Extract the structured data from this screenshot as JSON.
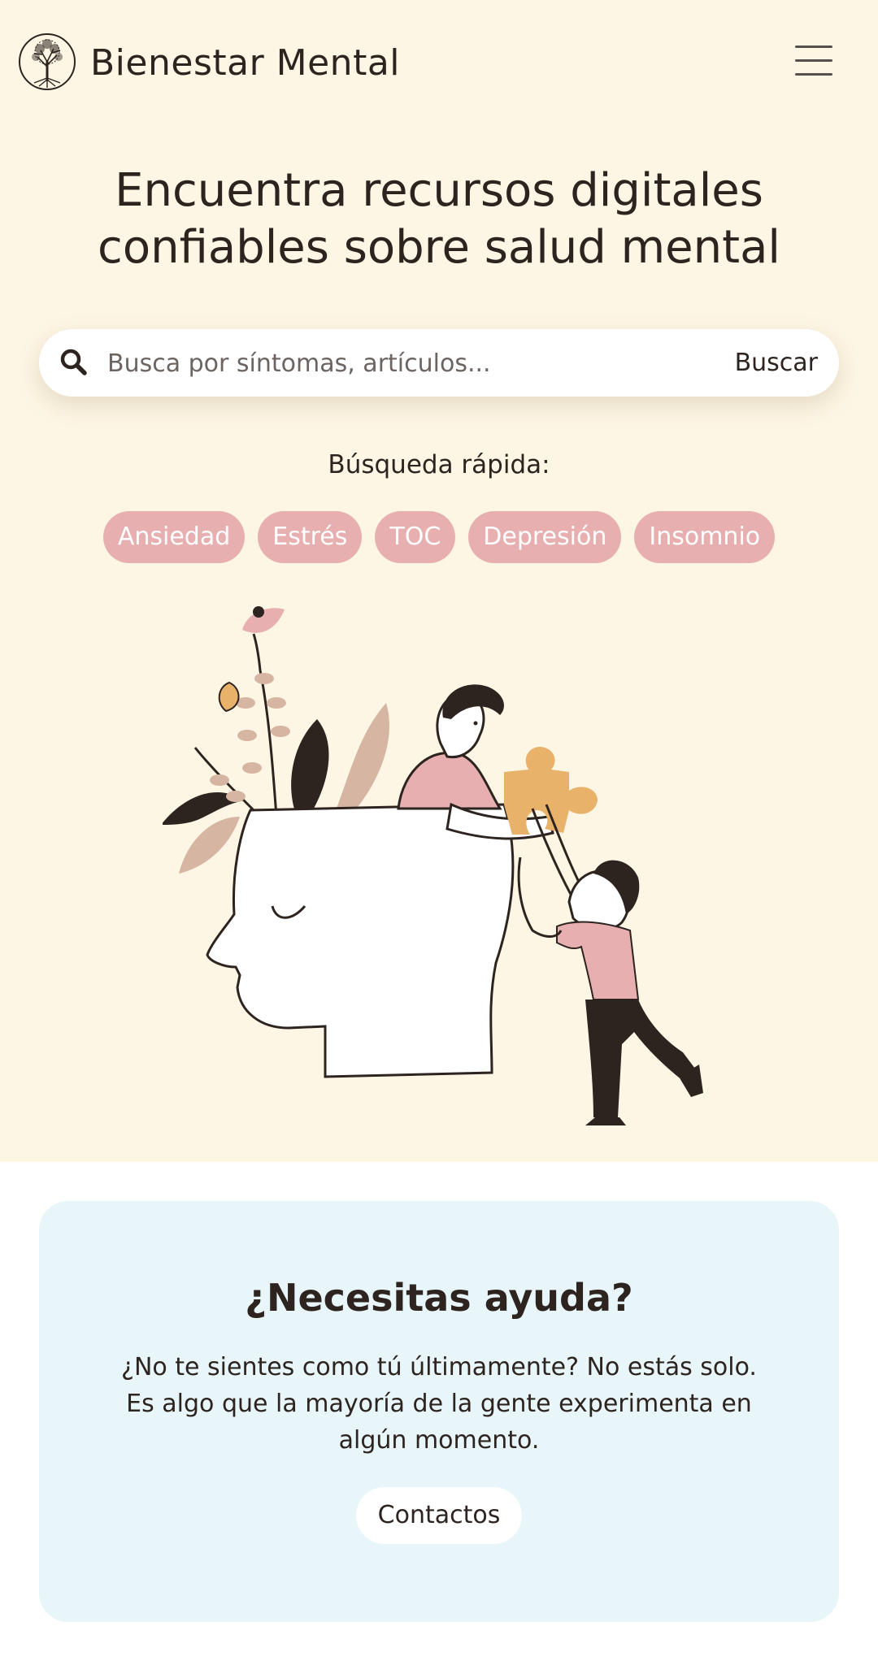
{
  "header": {
    "brand": "Bienestar Mental",
    "logo_icon": "tree-of-life-icon",
    "menu_icon": "hamburger-menu-icon"
  },
  "hero": {
    "headline_line1": "Encuentra recursos digitales",
    "headline_line2": "confiables sobre salud mental",
    "background_color": "#fdf6e4"
  },
  "search": {
    "icon": "search-icon",
    "placeholder": "Busca por síntomas, artículos...",
    "value": "",
    "button_label": "Buscar"
  },
  "quick_search": {
    "label": "Búsqueda rápida:",
    "chip_color": "#e8afb1",
    "chips": [
      "Ansiedad",
      "Estrés",
      "TOC",
      "Depresión",
      "Insomnio"
    ]
  },
  "help": {
    "title": "¿Necesitas ayuda?",
    "text": "¿No te sientes como tú últimamente? No estás solo. Es algo que la mayoría de la gente experimenta en algún momento.",
    "button_label": "Contactos",
    "background_color": "#e8f5f9"
  }
}
